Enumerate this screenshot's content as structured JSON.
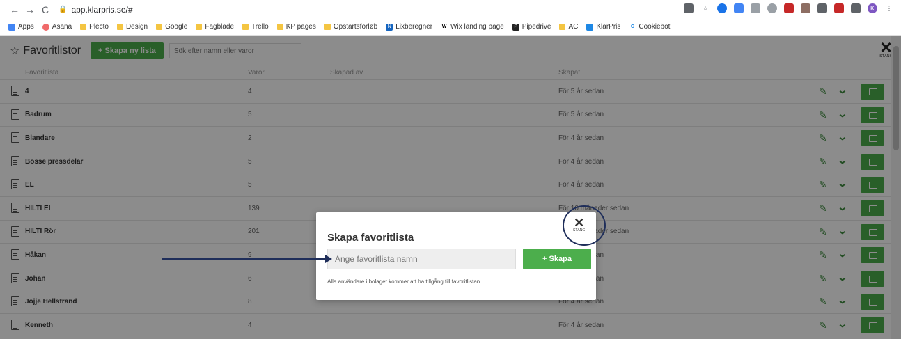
{
  "browser": {
    "url": "app.klarpris.se/#",
    "bookmarks": [
      "Apps",
      "Asana",
      "Plecto",
      "Design",
      "Google",
      "Fagblade",
      "Trello",
      "KP pages",
      "Opstartsforløb",
      "Lixberegner",
      "Wix landing page",
      "Pipedrive",
      "AC",
      "KlarPris",
      "Cookiebot"
    ],
    "avatar_letter": "K"
  },
  "app": {
    "title": "Favoritlistor",
    "new_button": "+ Skapa ny lista",
    "search_placeholder": "Sök efter namn eller varor",
    "close_label": "STÄNG",
    "columns": {
      "list": "Favoritlista",
      "items": "Varor",
      "created_by": "Skapad av",
      "created": "Skapat"
    },
    "rows": [
      {
        "name": "4",
        "count": "4",
        "created": "För 5 år sedan"
      },
      {
        "name": "Badrum",
        "count": "5",
        "created": "För 5 år sedan"
      },
      {
        "name": "Blandare",
        "count": "2",
        "created": "För 4 år sedan"
      },
      {
        "name": "Bosse pressdelar",
        "count": "5",
        "created": "För 4 år sedan"
      },
      {
        "name": "EL",
        "count": "5",
        "created": "För 4 år sedan"
      },
      {
        "name": "HILTI El",
        "count": "139",
        "created": "För 10 månader sedan"
      },
      {
        "name": "HILTI Rör",
        "count": "201",
        "created": "För 10 månader sedan"
      },
      {
        "name": "Håkan",
        "count": "9",
        "created": "För 4 år sedan"
      },
      {
        "name": "Johan",
        "count": "6",
        "created": "För 4 år sedan"
      },
      {
        "name": "Jojje Hellstrand",
        "count": "8",
        "created": "För 4 år sedan"
      },
      {
        "name": "Kenneth",
        "count": "4",
        "created": "För 4 år sedan"
      }
    ]
  },
  "modal": {
    "title": "Skapa favoritlista",
    "input_placeholder": "Ange favoritlista namn",
    "create_button": "+ Skapa",
    "note": "Alla användare i bolaget kommer att ha tillgång till favoritlistan",
    "close_label": "STÄNG"
  },
  "colors": {
    "accent_green": "#4cae4c",
    "annotation": "#1f2e5a"
  }
}
